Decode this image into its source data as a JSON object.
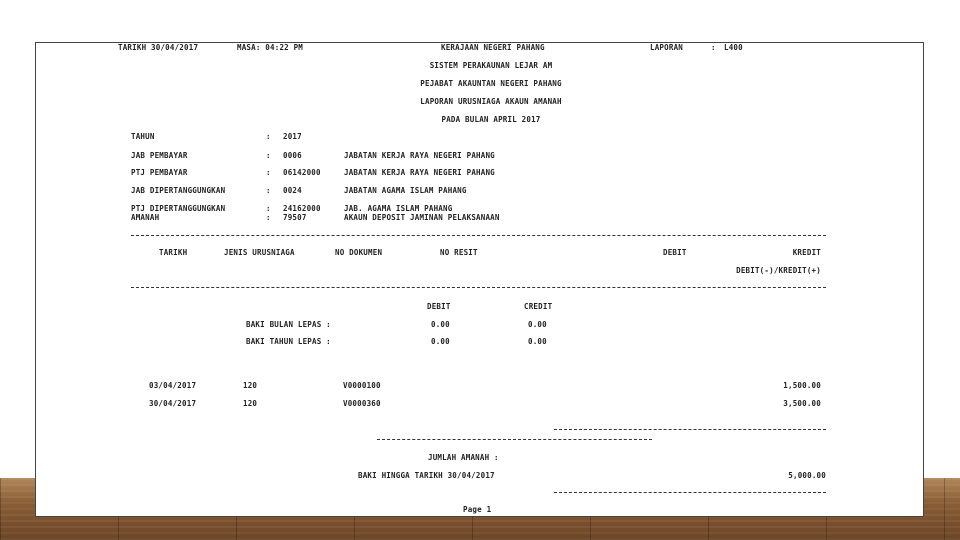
{
  "header": {
    "tarikh": "TARIKH   30/04/2017",
    "masa": "MASA: 04:22 PM",
    "kerajaan": "KERAJAAN NEGERI  PAHANG",
    "laporan_label": "LAPORAN",
    "laporan_colon": ":",
    "laporan_code": "L400"
  },
  "titles": {
    "line1": "SISTEM PERAKAUNAN LEJAR AM",
    "line2": "PEJABAT AKAUNTAN NEGERI PAHANG",
    "line3": "LAPORAN URUSNIAGA AKAUN AMANAH",
    "line4": "PADA BULAN  APRIL 2017"
  },
  "info": [
    {
      "label": "TAHUN",
      "code": "2017",
      "desc": ""
    },
    {
      "label": "JAB PEMBAYAR",
      "code": "0006",
      "desc": "JABATAN  KERJA RAYA NEGERI PAHANG"
    },
    {
      "label": "PTJ PEMBAYAR",
      "code": "06142000",
      "desc": "JABATAN KERJA RAYA NEGERI PAHANG"
    },
    {
      "label": "JAB DIPERTANGGUNGKAN",
      "code": "0024",
      "desc": "JABATAN  AGAMA ISLAM PAHANG"
    },
    {
      "label": "PTJ DIPERTANGGUNGKAN",
      "code": "24162000",
      "desc": "JAB. AGAMA ISLAM PAHANG"
    },
    {
      "label": "AMANAH",
      "code": "79507",
      "desc": "AKAUN DEPOSIT JAMINAN PELAKSANAAN"
    }
  ],
  "colon": ":",
  "columns": {
    "tarikh": "TARIKH",
    "jenis": "JENIS URUSNIAGA",
    "no_dokumen": "NO DOKUMEN",
    "no_resit": "NO RESIT",
    "debit": "DEBIT",
    "kredit": "KREDIT",
    "sub": "DEBIT(-)/KREDIT(+)"
  },
  "baki": {
    "debit_label": "DEBIT",
    "credit_label": "CREDIT",
    "bulan_label": "BAKI BULAN LEPAS :",
    "bulan_debit": "0.00",
    "bulan_credit": "0.00",
    "tahun_label": "BAKI TAHUN LEPAS :",
    "tahun_debit": "0.00",
    "tahun_credit": "0.00"
  },
  "rows": [
    {
      "tarikh": "03/04/2017",
      "jenis": "120",
      "dokumen": "V0000100",
      "amount": "1,500.00"
    },
    {
      "tarikh": "30/04/2017",
      "jenis": "120",
      "dokumen": "V0000360",
      "amount": "3,500.00"
    }
  ],
  "footer": {
    "jumlah": "JUMLAH AMANAH :",
    "baki_hingga": "BAKI HINGGA TARIKH 30/04/2017",
    "total": "5,000.00",
    "page": "Page  1"
  }
}
